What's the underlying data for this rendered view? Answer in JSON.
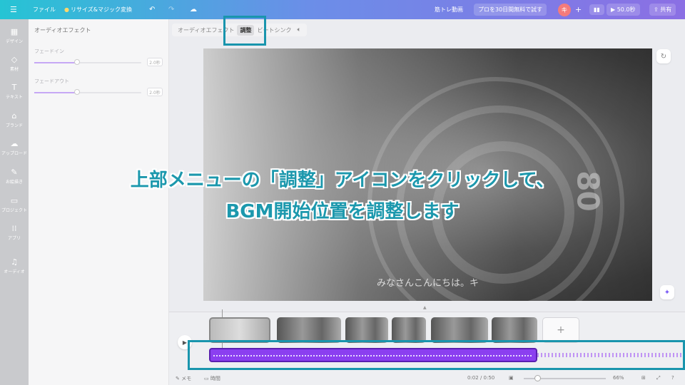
{
  "topbar": {
    "menu_icon": "hamburger-icon",
    "file_label": "ファイル",
    "resize_label": "リサイズ&マジック変換",
    "doc_title": "筋トレ動画",
    "pro_trial_label": "プロを30日間無料で試す",
    "avatar_initial": "キ",
    "duration_label": "50.0秒",
    "share_label": "共有"
  },
  "rail": {
    "items": [
      {
        "label": "デザイン",
        "icon": "design-icon"
      },
      {
        "label": "素材",
        "icon": "elements-icon"
      },
      {
        "label": "テキスト",
        "icon": "text-icon"
      },
      {
        "label": "ブランド",
        "icon": "brand-icon"
      },
      {
        "label": "アップロード",
        "icon": "upload-icon"
      },
      {
        "label": "お絵描き",
        "icon": "draw-icon"
      },
      {
        "label": "プロジェクト",
        "icon": "folder-icon"
      },
      {
        "label": "アプリ",
        "icon": "apps-icon"
      },
      {
        "label": "オーディオ",
        "icon": "music-icon"
      }
    ]
  },
  "panel": {
    "title": "オーディオエフェクト",
    "fade_in_label": "フェードイン",
    "fade_in_value": "2.0秒",
    "fade_out_label": "フェードアウト",
    "fade_out_value": "2.0秒",
    "fade_in_fraction": 0.4,
    "fade_out_fraction": 0.4
  },
  "editor": {
    "tabs": [
      {
        "label": "オーディオエフェクト",
        "active": false
      },
      {
        "label": "調整",
        "active": true
      },
      {
        "label": "ビートシンク",
        "active": false
      }
    ],
    "speaker_icon": "speaker-icon",
    "subtitle": "みなさんこんにちは。キ",
    "lens_text": "80"
  },
  "timeline": {
    "add_clip_label": "+",
    "memo_label": "メモ",
    "time_label": "時間",
    "time_readout": "0:02 / 0:50",
    "zoom_percent": "66%"
  },
  "caption": {
    "line1": "上部メニューの「調整」アイコンをクリックして、",
    "line2": "BGM開始位置を調整します"
  },
  "colors": {
    "highlight": "#1995ad",
    "audio_track": "#8b3ff0",
    "caption_text": "#1c98ad"
  }
}
